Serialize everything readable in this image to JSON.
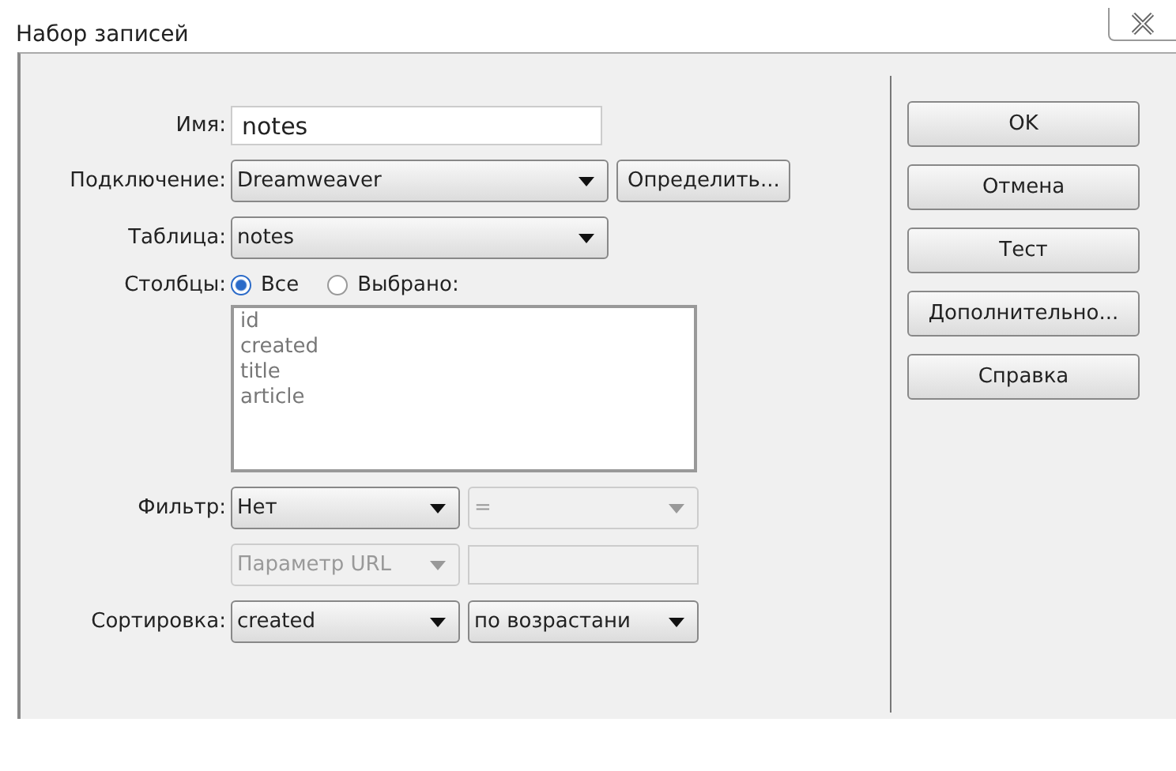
{
  "window": {
    "title": "Набор записей"
  },
  "form": [
    {
      "kind": "text",
      "label": "Имя:",
      "value": "notes",
      "disabled": false
    },
    {
      "kind": "select-button",
      "label": "Подключение:",
      "value": "Dreamweaver",
      "disabled": false,
      "button": "Определить..."
    },
    {
      "kind": "select",
      "label": "Таблица:",
      "value": "notes",
      "disabled": false
    },
    {
      "kind": "radios",
      "label": "Столбцы:",
      "options": [
        {
          "label": "Все",
          "selected": true
        },
        {
          "label": "Выбрано:",
          "selected": false
        }
      ]
    },
    {
      "kind": "list",
      "items": [
        "id",
        "created",
        "title",
        "article"
      ]
    },
    {
      "kind": "pair",
      "label": "Фильтр:",
      "first": {
        "value": "Нет",
        "disabled": false
      },
      "second": {
        "kind": "select",
        "value": "=",
        "disabled": true
      }
    },
    {
      "kind": "pair",
      "first": {
        "value": "Параметр URL",
        "disabled": true
      },
      "second": {
        "kind": "text",
        "disabled": true
      }
    },
    {
      "kind": "pair",
      "label": "Сортировка:",
      "first": {
        "value": "created",
        "disabled": false
      },
      "second": {
        "kind": "select",
        "value": "по возрастани",
        "disabled": false
      }
    }
  ],
  "buttons": [
    "OK",
    "Отмена",
    "Тест",
    "Дополнительно...",
    "Справка"
  ]
}
